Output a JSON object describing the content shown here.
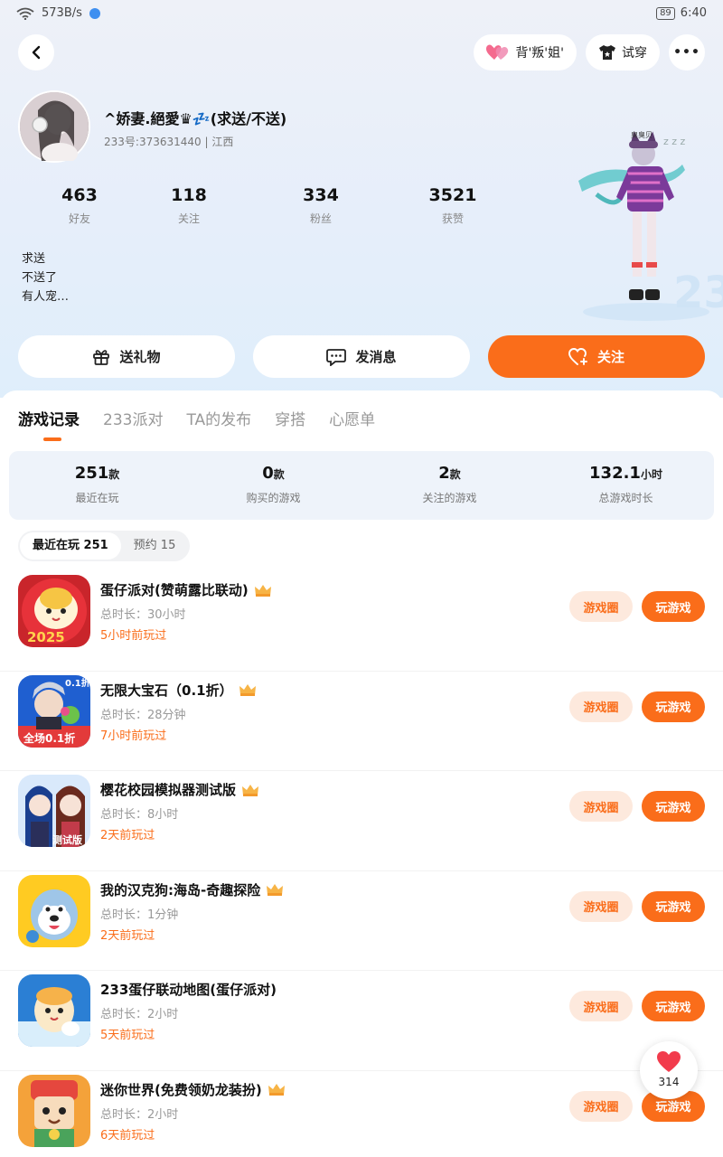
{
  "status_bar": {
    "network_speed": "573B/s",
    "battery": "89",
    "time": "6:40"
  },
  "header": {
    "tag_label": "背'叛'姐'",
    "tryon_label": "试穿",
    "more_label": "•••"
  },
  "profile": {
    "username": "^娇妻.絕愛♛💤(求送/不送)",
    "id_text": "233号:373631440 | 江西",
    "stats": [
      {
        "value": "463",
        "label": "好友"
      },
      {
        "value": "118",
        "label": "关注"
      },
      {
        "value": "334",
        "label": "粉丝"
      },
      {
        "value": "3521",
        "label": "获赞"
      }
    ],
    "bio_lines": [
      "求送",
      "不送了",
      "有人宠…"
    ],
    "avatar_nameplate": "臭臭贝"
  },
  "actions": {
    "gift_label": "送礼物",
    "message_label": "发消息",
    "follow_label": "关注"
  },
  "tabs": [
    "游戏记录",
    "233派对",
    "TA的发布",
    "穿搭",
    "心愿单"
  ],
  "summary": [
    {
      "num": "251",
      "unit": "款",
      "label": "最近在玩"
    },
    {
      "num": "0",
      "unit": "款",
      "label": "购买的游戏"
    },
    {
      "num": "2",
      "unit": "款",
      "label": "关注的游戏"
    },
    {
      "num": "132.1",
      "unit": "小时",
      "label": "总游戏时长"
    }
  ],
  "subtabs": [
    "最近在玩 251",
    "预约 15"
  ],
  "games": [
    {
      "name": "蛋仔派对(赞萌露比联动)",
      "total": "总时长：30小时",
      "last": "5小时前玩过",
      "circle": "游戏圈",
      "play": "玩游戏"
    },
    {
      "name": "无限大宝石（0.1折）",
      "total": "总时长：28分钟",
      "last": "7小时前玩过",
      "circle": "游戏圈",
      "play": "玩游戏"
    },
    {
      "name": "樱花校园模拟器测试版",
      "total": "总时长：8小时",
      "last": "2天前玩过",
      "circle": "游戏圈",
      "play": "玩游戏"
    },
    {
      "name": "我的汉克狗:海岛-奇趣探险",
      "total": "总时长：1分钟",
      "last": "2天前玩过",
      "circle": "游戏圈",
      "play": "玩游戏"
    },
    {
      "name": "233蛋仔联动地图(蛋仔派对)",
      "total": "总时长：2小时",
      "last": "5天前玩过",
      "circle": "游戏圈",
      "play": "玩游戏"
    },
    {
      "name": "迷你世界(免费领奶龙装扮)",
      "total": "总时长：2小时",
      "last": "6天前玩过",
      "circle": "游戏圈",
      "play": "玩游戏"
    }
  ],
  "game_badges": {
    "g1_year": "2025",
    "g2_tag": "0.1折",
    "g2_banner": "全场0.1折",
    "g3_tag": "测试版"
  },
  "like_float": {
    "count": "314"
  },
  "colors": {
    "accent": "#fa6d1a",
    "accent_light": "#fde9dd",
    "hero_bg": "#e6eefa"
  }
}
